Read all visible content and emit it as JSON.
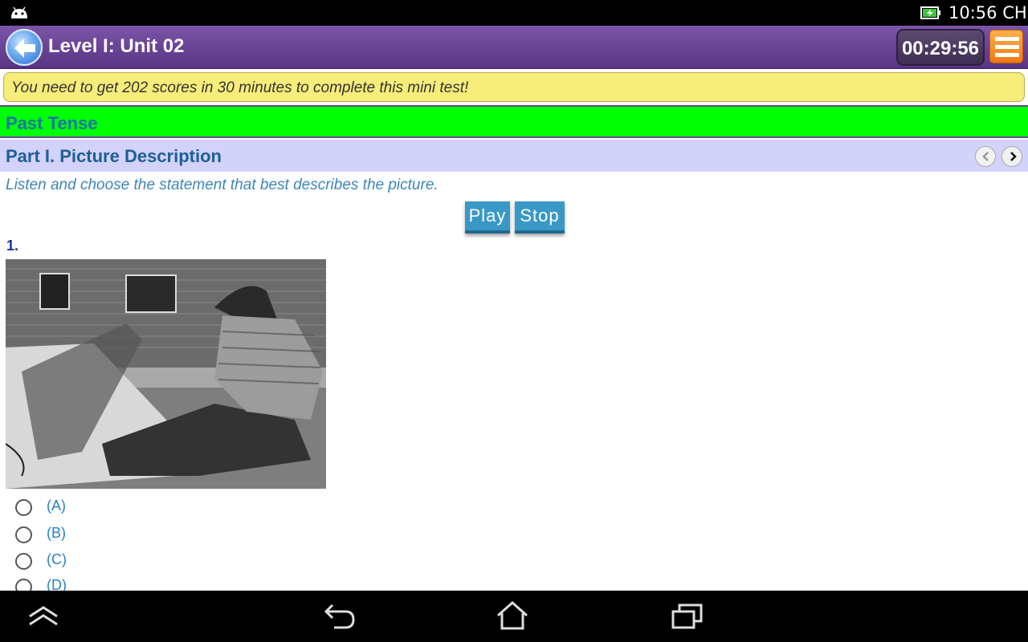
{
  "status_bar": {
    "clock": "10:56 CH",
    "icons": [
      "android-icon",
      "battery-charging-icon"
    ]
  },
  "header": {
    "title": "Level I: Unit 02",
    "timer": "00:29:56",
    "back_icon": "back-arrow-icon",
    "menu_icon": "menu-icon"
  },
  "notice": "You need to get 202 scores in 30 minutes to complete this mini test!",
  "topic": "Past Tense",
  "part": {
    "title": "Part I. Picture Description",
    "prev_icon": "chevron-left-icon",
    "next_icon": "chevron-right-icon"
  },
  "instruction": "Listen and choose the statement that best describes the picture.",
  "controls": {
    "play": "Play",
    "stop": "Stop"
  },
  "question": {
    "number": "1.",
    "options": [
      {
        "label": "(A)"
      },
      {
        "label": "(B)"
      },
      {
        "label": "(C)"
      },
      {
        "label": "(D)"
      }
    ]
  },
  "nav_bar": {
    "icons": [
      "home-up-icon",
      "back-icon",
      "home-icon",
      "recent-apps-icon"
    ]
  },
  "colors": {
    "header": "#6a4496",
    "notice": "#f7ed7a",
    "topic_bar": "#00ff00",
    "part_bar": "#d2d2fa",
    "button": "#3a98c6",
    "timer_box": "#4a3a60",
    "menu": "#f58a1f"
  }
}
